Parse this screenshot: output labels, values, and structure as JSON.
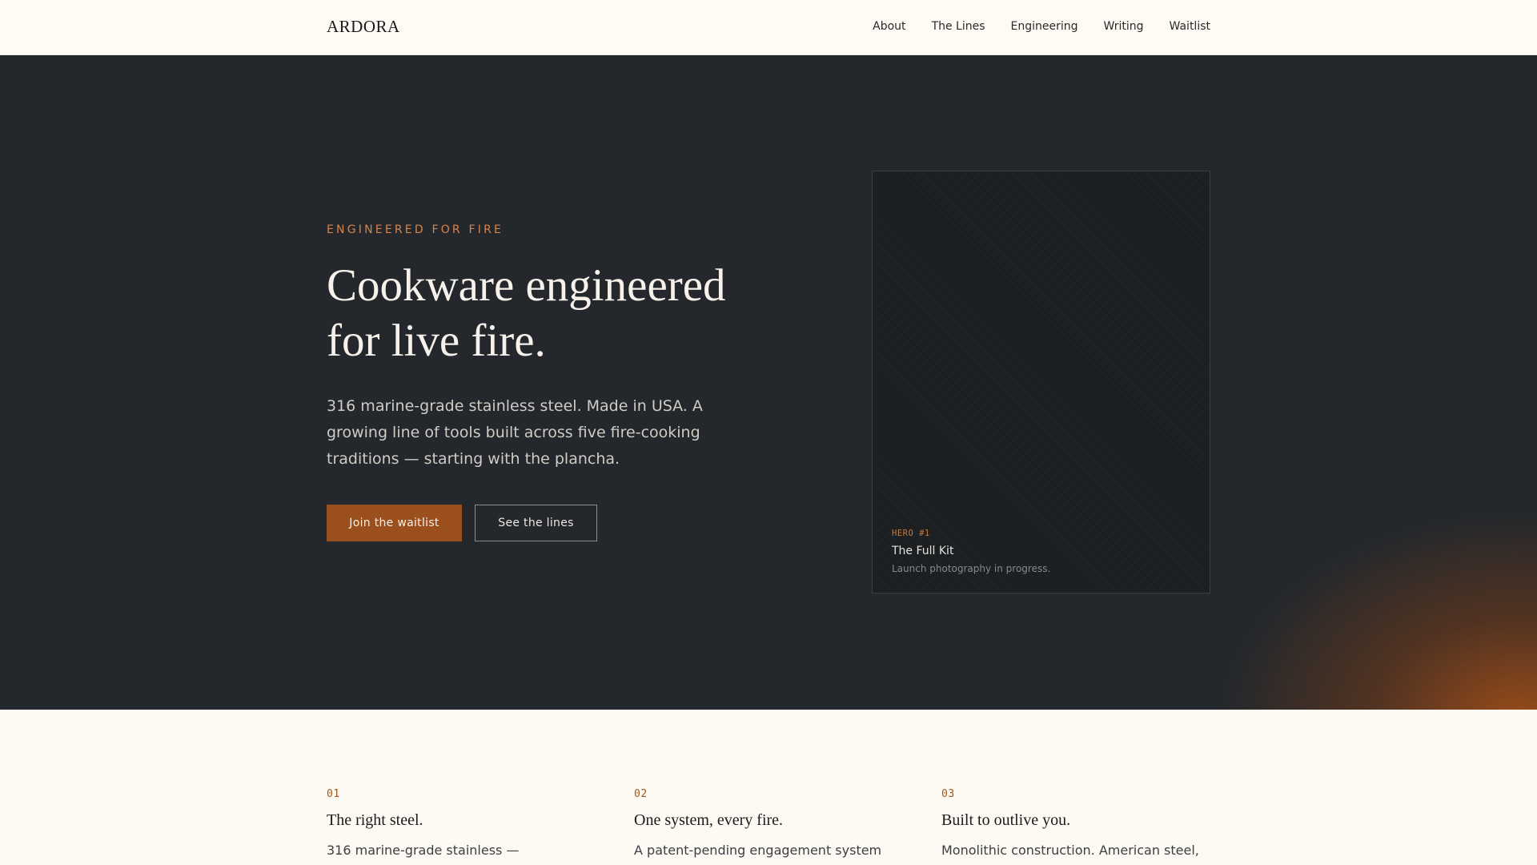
{
  "header": {
    "brand": "ARDORA",
    "nav": [
      "About",
      "The Lines",
      "Engineering",
      "Writing",
      "Waitlist"
    ]
  },
  "hero": {
    "eyebrow": "ENGINEERED FOR FIRE",
    "headline": "Cookware engineered for live fire.",
    "lede": "316 marine-grade stainless steel. Made in USA. A growing line of tools built across five fire-cooking traditions — starting with the plancha.",
    "primary_cta": "Join the waitlist",
    "secondary_cta": "See the lines"
  },
  "hero_card": {
    "tag": "HERO #1",
    "title": "The Full Kit",
    "subtitle": "Launch photography in progress."
  },
  "features": [
    {
      "num": "01",
      "title": "The right steel.",
      "body": "316 marine-grade stainless —"
    },
    {
      "num": "02",
      "title": "One system, every fire.",
      "body": "A patent-pending engagement system"
    },
    {
      "num": "03",
      "title": "Built to outlive you.",
      "body": "Monolithic construction. American steel,"
    }
  ],
  "colors": {
    "accent": "#9a4f1c",
    "hero_bg": "#24282c",
    "page_bg": "#fdf9f3",
    "eyebrow": "#d6854a"
  }
}
